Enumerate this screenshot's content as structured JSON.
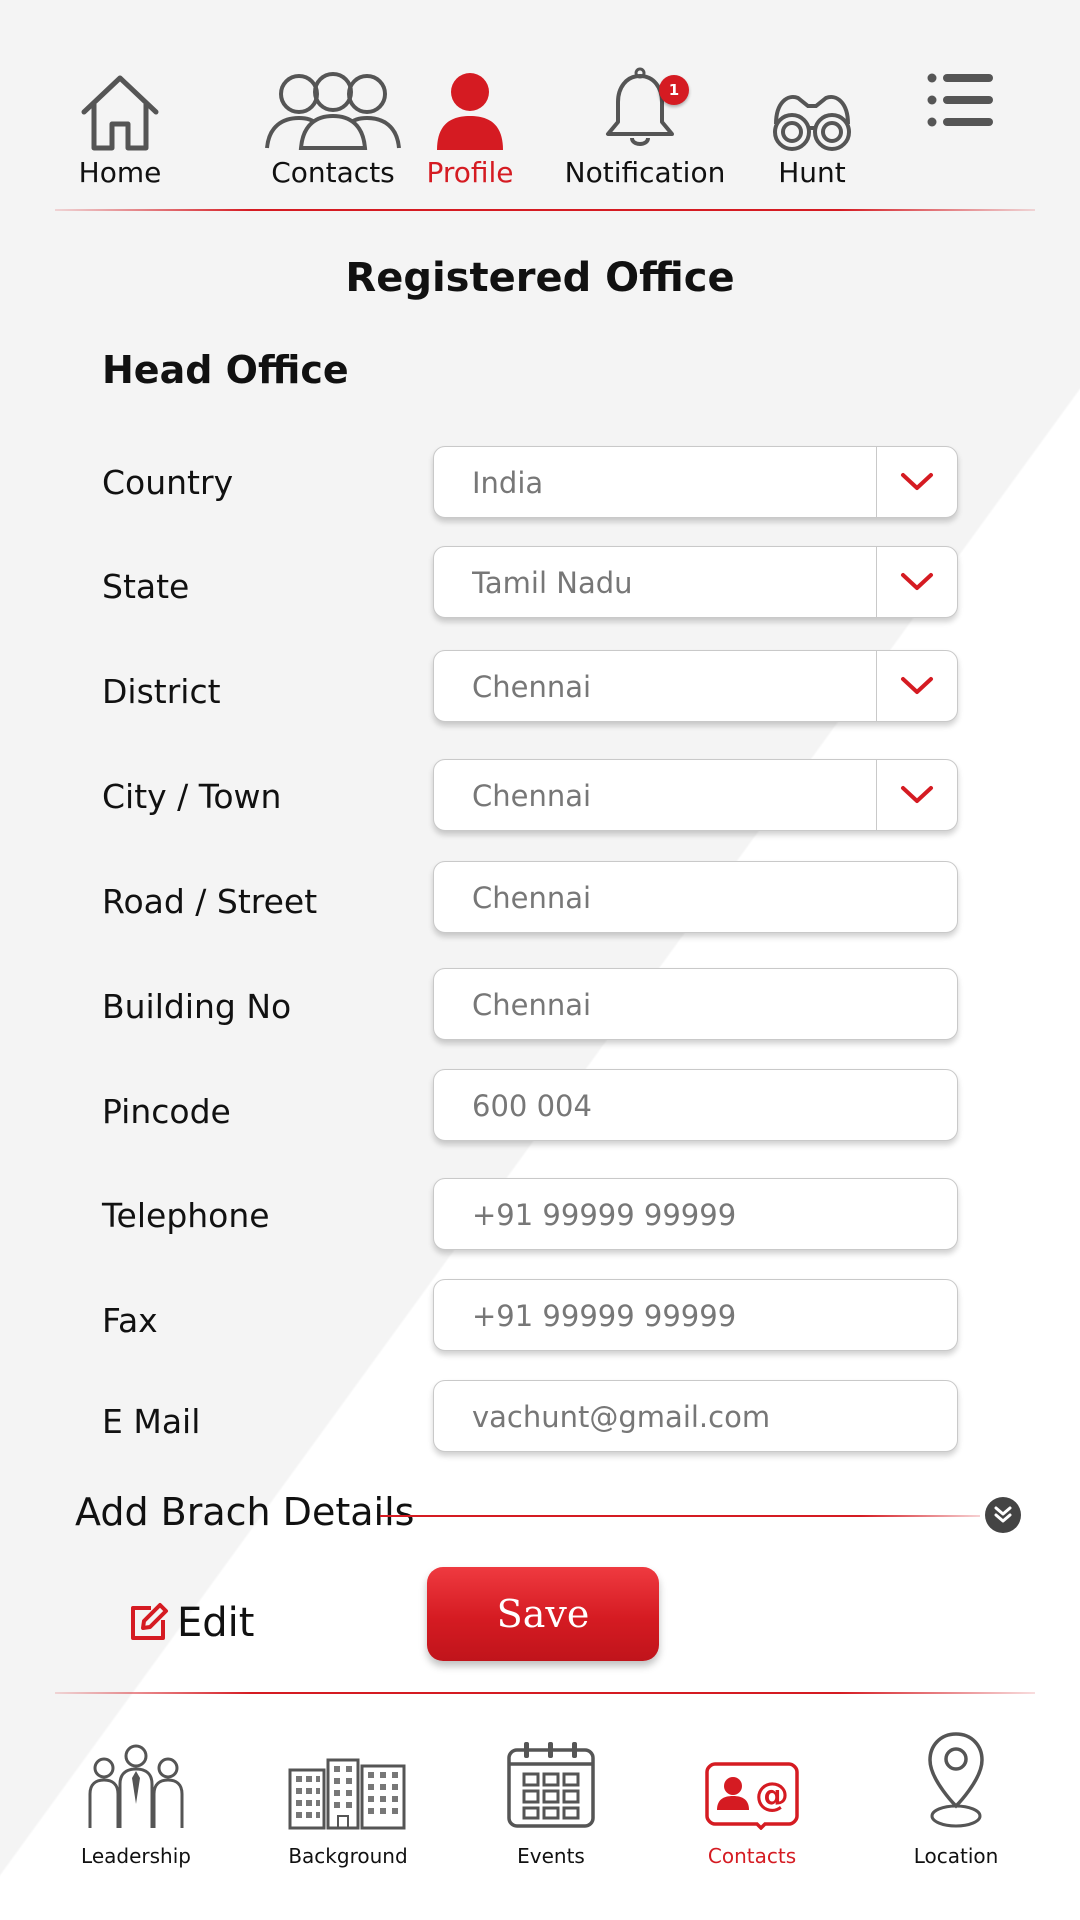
{
  "top_nav": {
    "items": [
      {
        "label": "Home",
        "icon": "home-icon"
      },
      {
        "label": "Contacts",
        "icon": "contacts-icon"
      },
      {
        "label": "Profile",
        "icon": "profile-icon"
      },
      {
        "label": "Notification",
        "icon": "bell-icon",
        "badge": "1"
      },
      {
        "label": "Hunt",
        "icon": "binoculars-icon"
      },
      {
        "label": "",
        "icon": "menu-icon"
      }
    ],
    "active": "Profile"
  },
  "page": {
    "title": "Registered Office",
    "section_title": "Head Office"
  },
  "form": {
    "country": {
      "label": "Country",
      "value": "India"
    },
    "state": {
      "label": "State",
      "value": "Tamil Nadu"
    },
    "district": {
      "label": "District",
      "value": "Chennai"
    },
    "city": {
      "label": "City / Town",
      "value": "Chennai"
    },
    "road": {
      "label": "Road / Street",
      "value": "Chennai"
    },
    "building": {
      "label": "Building No",
      "value": "Chennai"
    },
    "pincode": {
      "label": "Pincode",
      "value": "600 004"
    },
    "telephone": {
      "label": "Telephone",
      "value": "+91 99999 99999"
    },
    "fax": {
      "label": "Fax",
      "value": "+91 99999 99999"
    },
    "email": {
      "label": "E Mail",
      "value": "vachunt@gmail.com"
    }
  },
  "branch": {
    "label": "Add Brach Details"
  },
  "actions": {
    "edit_label": "Edit",
    "save_label": "Save"
  },
  "bottom_nav": {
    "items": [
      {
        "label": "Leadership",
        "icon": "leadership-icon"
      },
      {
        "label": "Background",
        "icon": "buildings-icon"
      },
      {
        "label": "Events",
        "icon": "calendar-icon"
      },
      {
        "label": "Contacts",
        "icon": "contact-card-icon"
      },
      {
        "label": "Location",
        "icon": "location-pin-icon"
      }
    ],
    "active": "Contacts"
  },
  "colors": {
    "accent": "#d51b22",
    "icon": "#555555",
    "text": "#111111",
    "value_text": "#777777"
  }
}
